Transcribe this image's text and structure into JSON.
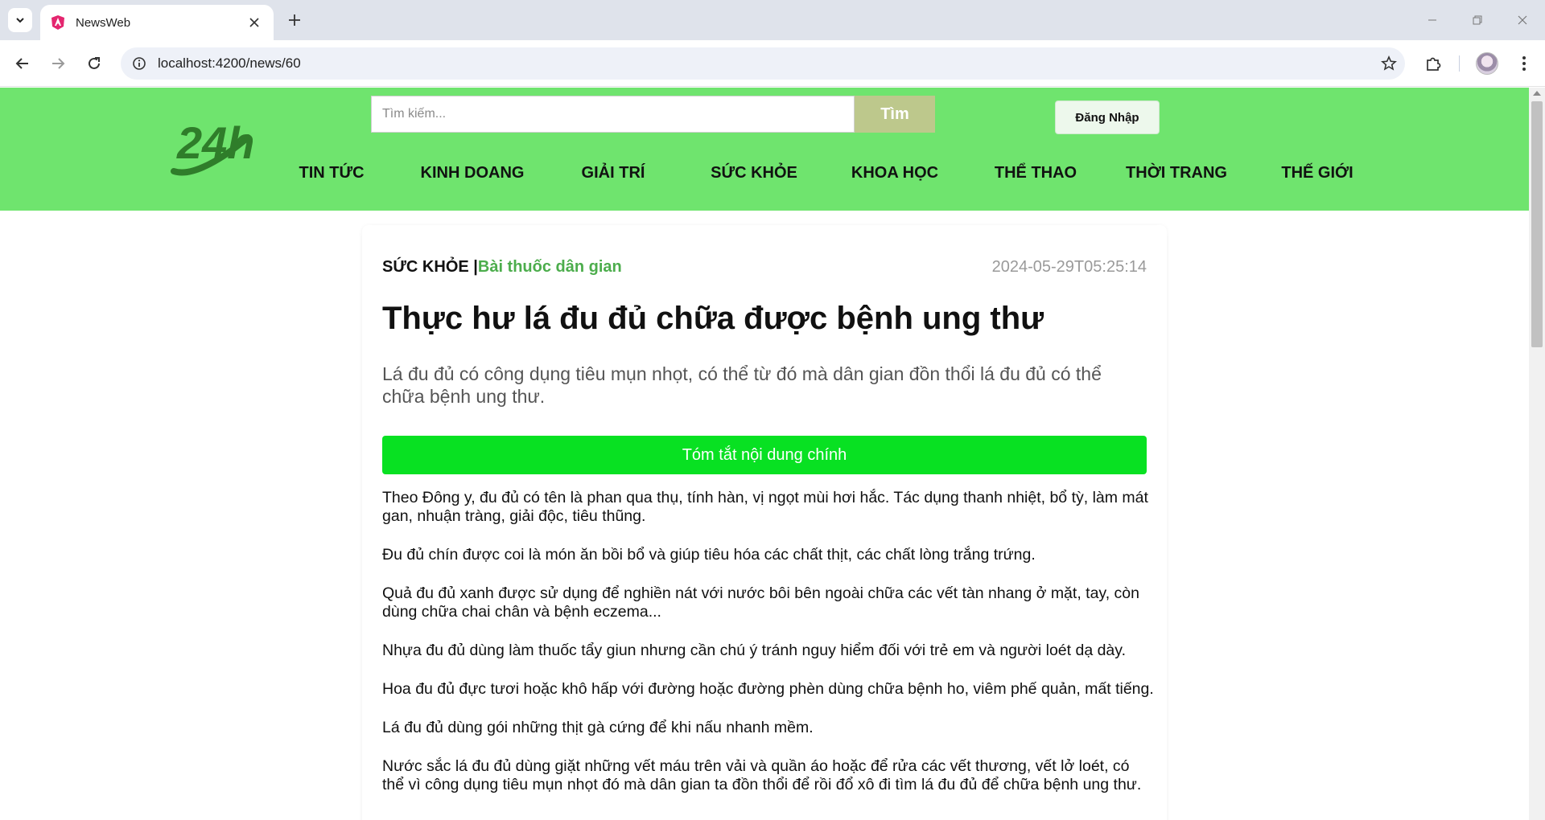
{
  "browser": {
    "tab_title": "NewsWeb",
    "url": "localhost:4200/news/60"
  },
  "site": {
    "logo_text": "24h",
    "search_placeholder": "Tìm kiếm...",
    "search_button": "Tìm",
    "login_button": "Đăng Nhập",
    "categories": [
      "TIN TỨC",
      "KINH DOANG",
      "GIẢI TRÍ",
      "SỨC KHỎE",
      "KHOA HỌC",
      "THỂ THAO",
      "THỜI TRANG",
      "THẾ GIỚI"
    ]
  },
  "article": {
    "category": "SỨC KHỎE |",
    "subcategory": "Bài thuốc dân gian",
    "date": "2024-05-29T05:25:14",
    "title": "Thực hư lá đu đủ chữa được bệnh ung thư",
    "sapo": "Lá đu đủ có công dụng tiêu mụn nhọt, có thể từ đó mà dân gian đồn thổi lá đu đủ có thể chữa bệnh ung thư.",
    "summary_button": "Tóm tắt nội dung chính",
    "paragraphs": [
      "Theo Đông y, đu đủ có tên là phan qua thụ, tính hàn, vị ngọt mùi hơi hắc. Tác dụng thanh nhiệt, bổ tỳ, làm mát gan, nhuận tràng, giải độc, tiêu thũng.",
      "Đu đủ chín được coi là món ăn bồi bổ và giúp tiêu hóa các chất thịt, các chất lòng trắng trứng.",
      "Quả đu đủ xanh được sử dụng để nghiền nát với nước bôi bên ngoài chữa các vết tàn nhang ở mặt, tay, còn dùng chữa chai chân và bệnh eczema...",
      "Nhựa đu đủ dùng làm thuốc tẩy giun nhưng cần chú ý tránh nguy hiểm đối với trẻ em và người loét dạ dày.",
      "Hoa đu đủ đực tươi hoặc khô hấp với đường hoặc đường phèn dùng chữa bệnh ho, viêm phế quản, mất tiếng.",
      "Lá đu đủ dùng gói những thịt gà cứng để khi nấu nhanh mềm.",
      "Nước sắc lá đu đủ dùng giặt những vết máu trên vải và quần áo hoặc để rửa các vết thương, vết lở loét, có thể vì công dụng tiêu mụn nhọt đó mà dân gian ta đồn thổi để rồi đổ xô đi tìm lá đu đủ để chữa bệnh ung thư."
    ]
  },
  "colors": {
    "header_bg": "#6fe46e",
    "summary_button": "#08e122",
    "subcategory": "#4cad4c"
  }
}
